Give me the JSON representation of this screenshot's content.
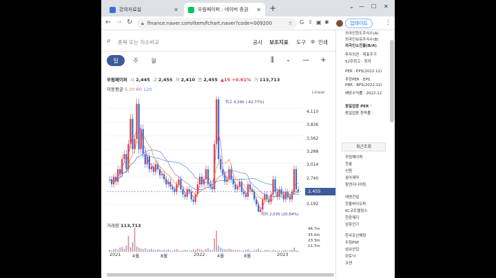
{
  "browser": {
    "tabs": [
      {
        "title": "강의자료실",
        "active": false,
        "favicon_color": "#3b6fd6"
      },
      {
        "title": "우림페이퍼 : 네이버 증권",
        "active": true,
        "favicon_color": "#03c75a"
      }
    ],
    "new_tab": "+",
    "url": "finance.naver.com/item/fchart.naver?code=009200",
    "update_button": "업데이트"
  },
  "header": {
    "search_placeholder": "종목 또는 지수비교",
    "menu": [
      "공시",
      "보조지표",
      "도구",
      "인쇄"
    ]
  },
  "periods": [
    "일",
    "주",
    "월"
  ],
  "quote": {
    "name": "우림페이퍼",
    "open_label": "시",
    "open": "2,445",
    "high_label": "고",
    "high": "2,455",
    "low_label": "저",
    "low": "2,410",
    "close_label": "종",
    "close": "2,455",
    "change": "▲15 +0.61%",
    "volume_label": "거",
    "volume": "113,713"
  },
  "moving_average": {
    "label": "이동평균",
    "p5": "5",
    "p20": "20",
    "p60": "60",
    "p120": "120"
  },
  "scale_mode": "Linear",
  "chart_data": {
    "type": "line",
    "title": "",
    "y_ticks": [
      "4,110",
      "3,836",
      "3,562",
      "3,288",
      "3,014",
      "2,740",
      "2,455",
      "2,192"
    ],
    "current_price": "2,455",
    "ylim": [
      2050,
      4350
    ],
    "annotations": {
      "high": "최고 4,290 (-42.77%)",
      "low": "최저 2,035 (20.64%)"
    },
    "x_labels": [
      "2021",
      "4월",
      "8월",
      "2022",
      "4월",
      "8월",
      "2023"
    ],
    "volume": {
      "label": "거래량",
      "value": "113,713",
      "ticks": [
        "46.7m",
        "35.0m",
        "23.3m",
        "11.7m"
      ]
    },
    "price_series": [
      2700,
      2600,
      2750,
      2650,
      2900,
      2800,
      3100,
      3200,
      2900,
      3400,
      3900,
      3300,
      3500,
      4200,
      3300,
      3700,
      3200,
      3000,
      3150,
      2900,
      2950,
      2850,
      3000,
      2900,
      2780,
      2800,
      2700,
      2600,
      2650,
      2550,
      2500,
      2450,
      2600,
      2700,
      2500,
      2400,
      2350,
      2500,
      2450,
      2300,
      2250,
      2400,
      2600,
      2750,
      2600,
      2700,
      2900,
      2600,
      2550,
      2500,
      3400,
      4290,
      3100,
      2900,
      2800,
      2650,
      2700,
      2900,
      2700,
      2600,
      2500,
      2550,
      2650,
      2450,
      2400,
      2350,
      2600,
      2500,
      2450,
      2300,
      2200,
      2035,
      2100,
      2300,
      2400,
      2300,
      2250,
      2400,
      2700,
      2450,
      2350,
      2500,
      2400,
      2300,
      2450,
      2350,
      2300,
      2450,
      2900,
      2500,
      2455
    ],
    "volume_series": [
      4,
      3,
      5,
      6,
      4,
      8,
      10,
      6,
      12,
      30,
      9,
      18,
      46,
      10,
      8,
      6,
      5,
      7,
      4,
      5,
      6,
      4,
      3,
      5,
      4,
      3,
      4,
      3,
      5,
      3,
      2,
      4,
      5,
      3,
      2,
      3,
      4,
      3,
      2,
      3,
      5,
      4,
      6,
      5,
      4,
      3,
      5,
      7,
      4,
      3,
      25,
      40,
      12,
      8,
      6,
      5,
      4,
      6,
      5,
      4,
      3,
      4,
      3,
      2,
      3,
      4,
      5,
      3,
      2,
      3,
      4,
      6,
      3,
      2,
      3,
      4,
      3,
      2,
      4,
      3,
      2,
      3,
      2,
      3,
      4,
      2,
      3,
      4,
      8,
      3,
      2
    ]
  },
  "sidebar": {
    "info_lines": [
      {
        "text": "외국인한도주식수(A)",
        "style": ""
      },
      {
        "text": "외국인보유주식수(B)",
        "style": ""
      },
      {
        "text": "외국인소진율(B/A)",
        "style": "bold"
      },
      {
        "text": "투자의견 · 목표주가",
        "style": ""
      },
      {
        "text": "52주최고 · 최저",
        "style": ""
      },
      {
        "text": "PER · EPS(2022.12)",
        "style": ""
      },
      {
        "text": "추정PER · EPS",
        "style": ""
      },
      {
        "text": "PBR · BPS(2022.12)",
        "style": ""
      },
      {
        "text": "배당수익률 · 2022.12",
        "style": ""
      },
      {
        "text": "동일업종 PER ·",
        "style": "bold"
      },
      {
        "text": "동일업종 등락률 ·",
        "style": ""
      }
    ],
    "recent_title": "최근조회",
    "recent_items": [
      "우림페이퍼",
      "한솔",
      "신원",
      "삼아제약",
      "참엔지니어링",
      "태영건설",
      "한올바이오파",
      "KC코트렐링스",
      "한창제지",
      "상화전기",
      "한국조선해양",
      "두림PSP",
      "삼보산업",
      "모토닉",
      "코센"
    ]
  }
}
